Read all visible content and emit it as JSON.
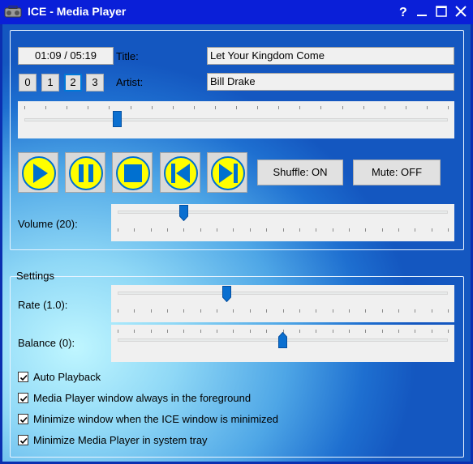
{
  "window": {
    "title": "ICE - Media Player",
    "help_icon": "question-mark-icon",
    "minimize_icon": "minimize-icon",
    "maximize_icon": "maximize-icon",
    "close_icon": "close-icon",
    "title_bar_color": "#0a1fd8"
  },
  "player": {
    "time": "01:09 / 05:19",
    "title_label": "Title:",
    "title_value": "Let Your Kingdom Come",
    "artist_label": "Artist:",
    "artist_value": "Bill Drake",
    "presets": [
      "0",
      "1",
      "2",
      "3"
    ],
    "active_preset": "2",
    "seek_position_fraction": 0.22,
    "controls": {
      "play_icon": "play-icon",
      "pause_icon": "pause-icon",
      "stop_icon": "stop-icon",
      "previous_icon": "skip-previous-icon",
      "next_icon": "skip-next-icon",
      "icon_fill": "#ffff00",
      "icon_color": "#0070d0"
    },
    "shuffle_label": "Shuffle: ON",
    "mute_label": "Mute: OFF",
    "volume_label": "Volume (20):",
    "volume_value": 20,
    "volume_max": 100
  },
  "settings": {
    "group_label": "Settings",
    "rate_label": "Rate (1.0):",
    "rate_position_fraction": 0.33,
    "balance_label": "Balance (0):",
    "balance_position_fraction": 0.5,
    "checkboxes": [
      {
        "label": "Auto Playback",
        "checked": true
      },
      {
        "label": "Media Player window always in the foreground",
        "checked": true
      },
      {
        "label": "Minimize window when the ICE window is minimized",
        "checked": true
      },
      {
        "label": "Minimize Media Player in system tray",
        "checked": true
      }
    ]
  },
  "colors": {
    "accent": "#0078d7",
    "thumb": "#0a6fd0"
  }
}
